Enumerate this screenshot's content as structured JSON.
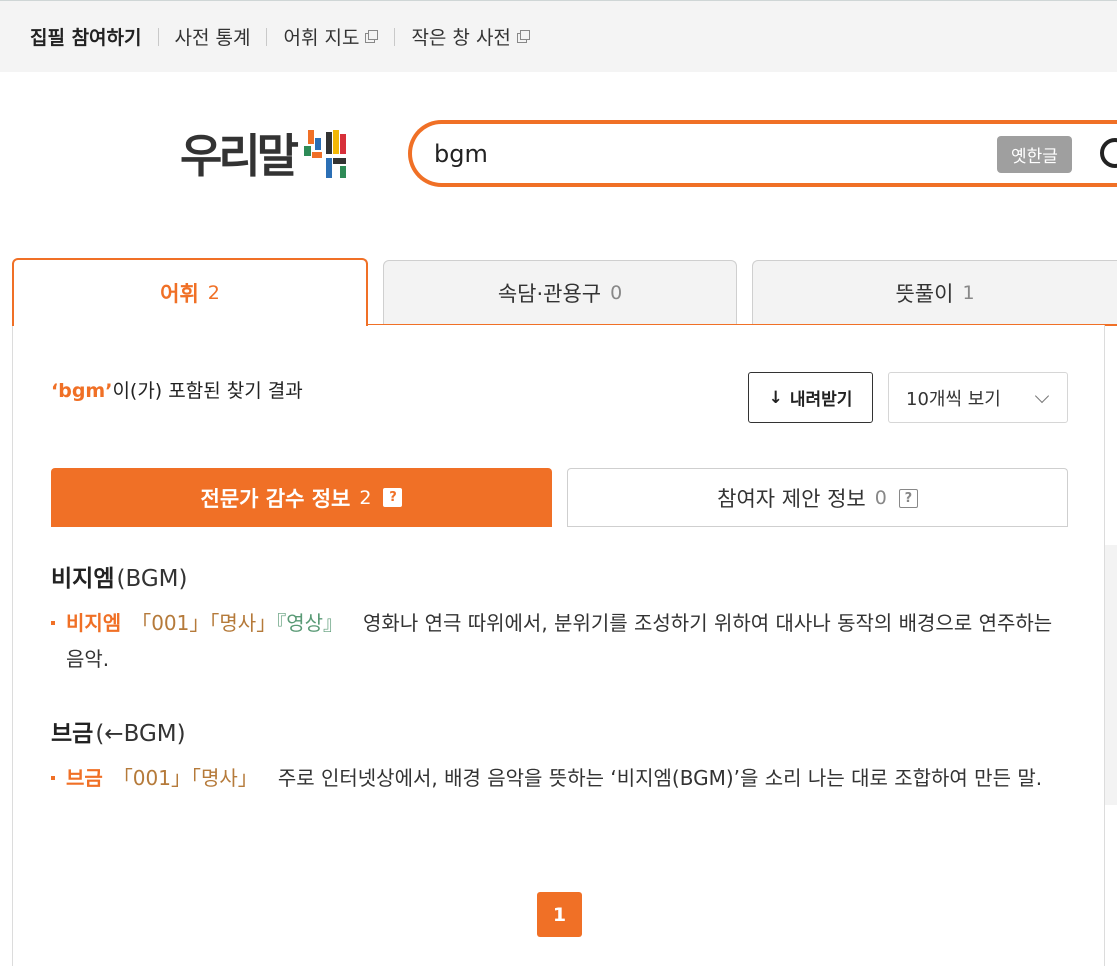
{
  "topnav": {
    "items": [
      {
        "label": "집필 참여하기"
      },
      {
        "label": "사전 통계"
      },
      {
        "label": "어휘 지도"
      },
      {
        "label": "작은 창 사전"
      }
    ]
  },
  "logo": {
    "text": "우리말",
    "mark": "샘"
  },
  "search": {
    "value": "bgm",
    "old_hangul_label": "옛한글"
  },
  "tabs": [
    {
      "label": "어휘",
      "count": "2"
    },
    {
      "label": "속담·관용구",
      "count": "0"
    },
    {
      "label": "뜻풀이",
      "count": "1"
    }
  ],
  "results": {
    "keyword": "‘bgm’",
    "suffix": "이(가) 포함된 찾기 결과",
    "download_label": "내려받기",
    "per_page": "10개씩 보기"
  },
  "subtabs": [
    {
      "label": "전문가 감수 정보",
      "count": "2"
    },
    {
      "label": "참여자 제안 정보",
      "count": "0"
    }
  ],
  "entries": [
    {
      "headword": "비지엠",
      "origin": "(BGM)",
      "sense_word": "비지엠",
      "number": "「001」",
      "pos": "「명사」",
      "field": "『영상』",
      "definition": "영화나 연극 따위에서, 분위기를 조성하기 위하여 대사나 동작의 배경으로 연주하는 음악."
    },
    {
      "headword": "브금",
      "origin": "(←BGM)",
      "sense_word": "브금",
      "number": "「001」",
      "pos": "「명사」",
      "definition": "주로 인터넷상에서, 배경 음악을 뜻하는 ‘비지엠(BGM)’을 소리 나는 대로 조합하여 만든 말."
    }
  ],
  "pagination": {
    "current": "1"
  },
  "colors": {
    "accent": "#f07026",
    "field": "#5a9a76",
    "pos": "#b57a3a"
  }
}
